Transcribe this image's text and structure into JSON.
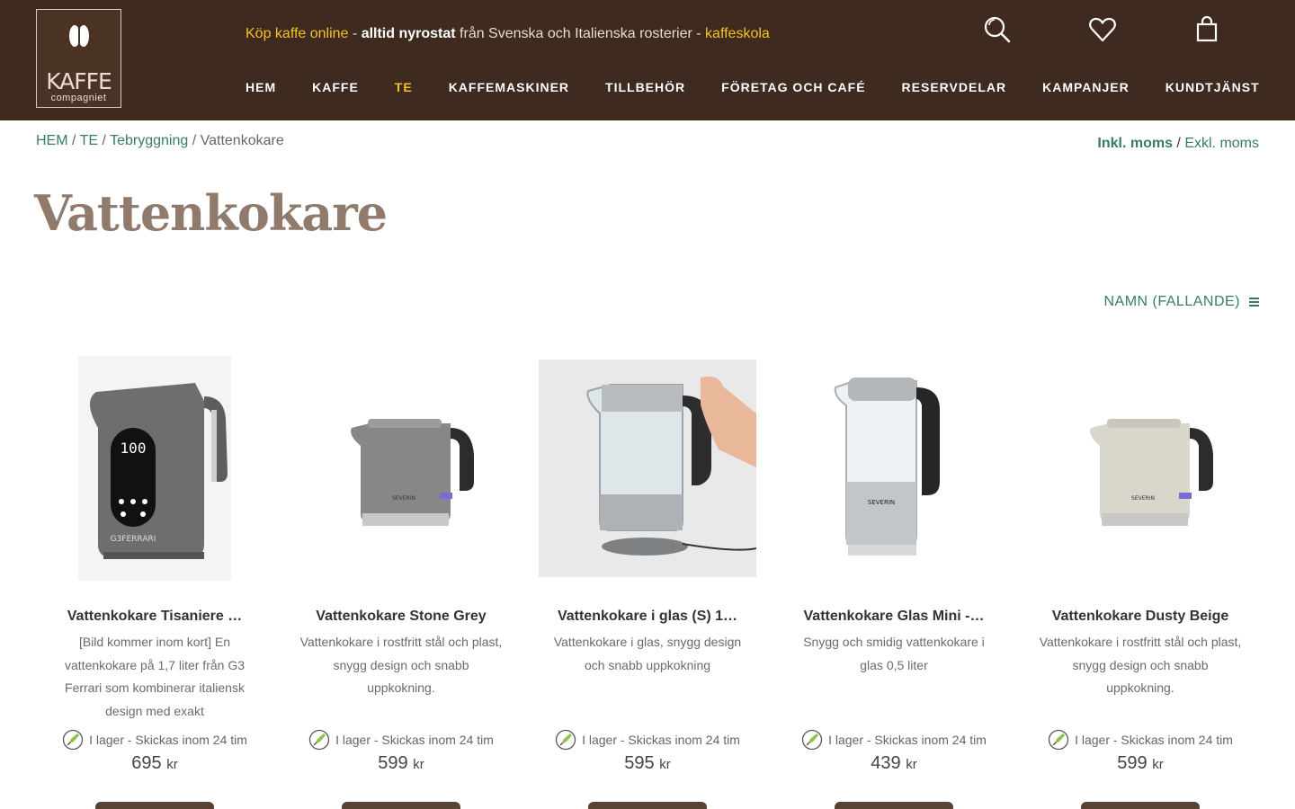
{
  "header": {
    "logo": {
      "brand": "KAFFE",
      "sub": "compagniet"
    },
    "tagline": {
      "part1": "Köp kaffe online",
      "sep1": " - ",
      "part2": "alltid nyrostat",
      "part3": " från Svenska och Italienska rosterier - ",
      "part4": "kaffeskola"
    },
    "icons": [
      "search-icon",
      "heart-icon",
      "bag-icon"
    ],
    "nav": [
      {
        "label": "HEM",
        "active": false
      },
      {
        "label": "KAFFE",
        "active": false
      },
      {
        "label": "TE",
        "active": true
      },
      {
        "label": "KAFFEMASKINER",
        "active": false
      },
      {
        "label": "TILLBEHÖR",
        "active": false
      },
      {
        "label": "FÖRETAG OCH CAFÉ",
        "active": false
      },
      {
        "label": "RESERVDELAR",
        "active": false
      },
      {
        "label": "KAMPANJER",
        "active": false
      },
      {
        "label": "KUNDTJÄNST",
        "active": false
      }
    ]
  },
  "breadcrumb": {
    "items": [
      "HEM",
      "TE",
      "Tebryggning"
    ],
    "current": "Vattenkokare",
    "sep": " / "
  },
  "vat": {
    "incl": "Inkl. moms",
    "sep": " / ",
    "excl": "Exkl. moms"
  },
  "page_title": "Vattenkokare",
  "sort": {
    "label": "NAMN (FALLANDE)"
  },
  "products": [
    {
      "name": "Vattenkokare Tisaniere …",
      "desc": "[Bild kommer inom kort] En vattenkokare på 1,7 liter från G3 Ferrari som kombinerar italiensk design med exakt",
      "stock": "I lager - Skickas inom 24 tim",
      "price": "695",
      "currency": "kr",
      "image": "g3-ferrari-kettle"
    },
    {
      "name": "Vattenkokare Stone Grey",
      "desc": "Vattenkokare i rostfritt stål och plast, snygg design och snabb uppkokning.",
      "stock": "I lager - Skickas inom 24 tim",
      "price": "599",
      "currency": "kr",
      "image": "grey-kettle"
    },
    {
      "name": "Vattenkokare i glas (S) 1…",
      "desc": "Vattenkokare i glas, snygg design och snabb uppkokning",
      "stock": "I lager - Skickas inom 24 tim",
      "price": "595",
      "currency": "kr",
      "image": "glass-kettle"
    },
    {
      "name": "Vattenkokare Glas Mini -…",
      "desc": "Snygg och smidig vattenkokare i glas 0,5 liter",
      "stock": "I lager - Skickas inom 24 tim",
      "price": "439",
      "currency": "kr",
      "image": "mini-glass-kettle"
    },
    {
      "name": "Vattenkokare Dusty Beige",
      "desc": "Vattenkokare i rostfritt stål och plast, snygg design och snabb uppkokning.",
      "stock": "I lager - Skickas inom 24 tim",
      "price": "599",
      "currency": "kr",
      "image": "beige-kettle"
    }
  ],
  "colors": {
    "header_bg": "#3e2a1f",
    "accent_yellow": "#f2c22b",
    "link_green": "#3a7d5c",
    "title_brown": "#8f7a6b",
    "button_brown": "#5a4335"
  }
}
